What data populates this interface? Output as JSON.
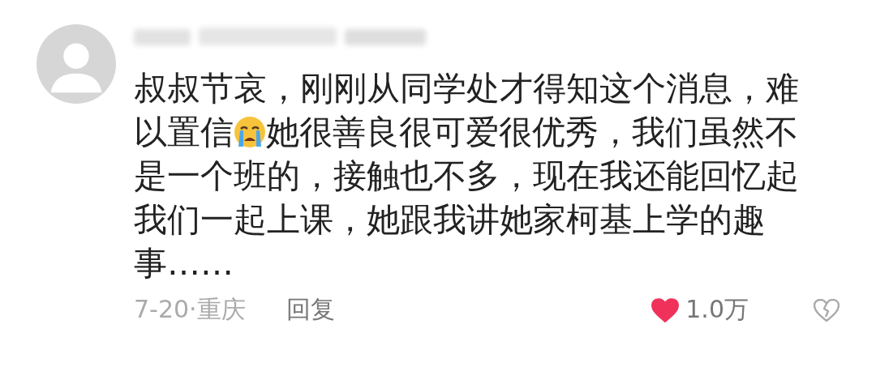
{
  "comment": {
    "lines": [
      {
        "parts": [
          {
            "kind": "text",
            "text": "叔叔节哀，刚刚从同学处才得知这个消息，难"
          }
        ]
      },
      {
        "parts": [
          {
            "kind": "text",
            "text": "以置信"
          },
          {
            "kind": "crying-emoji"
          },
          {
            "kind": "text",
            "text": "她很善良很可爱很优秀，我们虽然不"
          }
        ]
      },
      {
        "parts": [
          {
            "kind": "text",
            "text": "是一个班的，接触也不多，现在我还能回忆起"
          }
        ]
      },
      {
        "parts": [
          {
            "kind": "text",
            "text": "我们一起上课，她跟我讲她家柯基上学的趣"
          }
        ]
      },
      {
        "parts": [
          {
            "kind": "text",
            "text": "事……"
          }
        ]
      }
    ],
    "meta": "7-20·重庆",
    "reply": "回复",
    "likes": "1.0万",
    "liked": true
  }
}
